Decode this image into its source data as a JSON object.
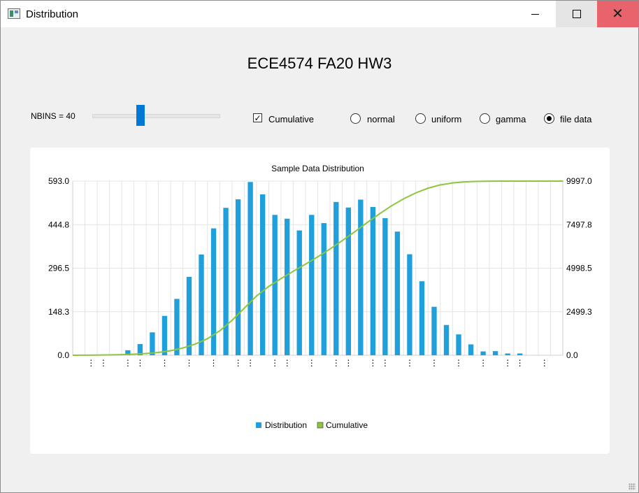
{
  "window": {
    "title": "Distribution",
    "controls": {
      "minimize": "minimize-icon",
      "maximize": "maximize-icon",
      "close": "close-icon"
    }
  },
  "heading": "ECE4574 FA20 HW3",
  "controls": {
    "nbins_label": "NBINS = 40",
    "slider": {
      "min": 1,
      "max": 100,
      "value": 40
    },
    "cumulative": {
      "label": "Cumulative",
      "checked": true
    },
    "distributions": [
      {
        "label": "normal",
        "checked": false
      },
      {
        "label": "uniform",
        "checked": false
      },
      {
        "label": "gamma",
        "checked": false
      },
      {
        "label": "file data",
        "checked": true
      }
    ]
  },
  "colors": {
    "distribution": "#1f9fdb",
    "cumulative": "#8cc63f",
    "accent": "#0078d7",
    "close_button": "#e9636d"
  },
  "chart_data": {
    "type": "bar",
    "title": "Sample Data Distribution",
    "xlabel": "",
    "ylabel": "",
    "ylim": [
      0,
      593.0
    ],
    "y2lim": [
      0,
      9997.0
    ],
    "y_ticks": [
      "0.0",
      "148.3",
      "296.5",
      "444.8",
      "593.0"
    ],
    "y2_ticks": [
      "0.0",
      "2499.3",
      "4998.5",
      "7497.8",
      "9997.0"
    ],
    "grid": true,
    "legend_position": "bottom",
    "series": [
      {
        "name": "Distribution",
        "values": [
          0,
          0,
          0,
          0,
          17,
          38,
          78,
          134,
          192,
          267,
          343,
          432,
          502,
          531,
          590,
          548,
          478,
          465,
          425,
          478,
          450,
          522,
          503,
          530,
          505,
          467,
          421,
          344,
          252,
          165,
          103,
          71,
          37,
          13,
          14,
          6,
          6,
          0,
          0,
          0
        ]
      },
      {
        "name": "Cumulative",
        "values": [
          5,
          10,
          20,
          35,
          60,
          100,
          160,
          260,
          420,
          640,
          950,
          1400,
          2000,
          2700,
          3400,
          3950,
          4400,
          4820,
          5230,
          5650,
          6100,
          6580,
          7080,
          7600,
          8100,
          8570,
          8980,
          9320,
          9590,
          9780,
          9890,
          9950,
          9980,
          9992,
          9995,
          9996,
          9997,
          9997,
          9997,
          9997
        ]
      }
    ]
  }
}
